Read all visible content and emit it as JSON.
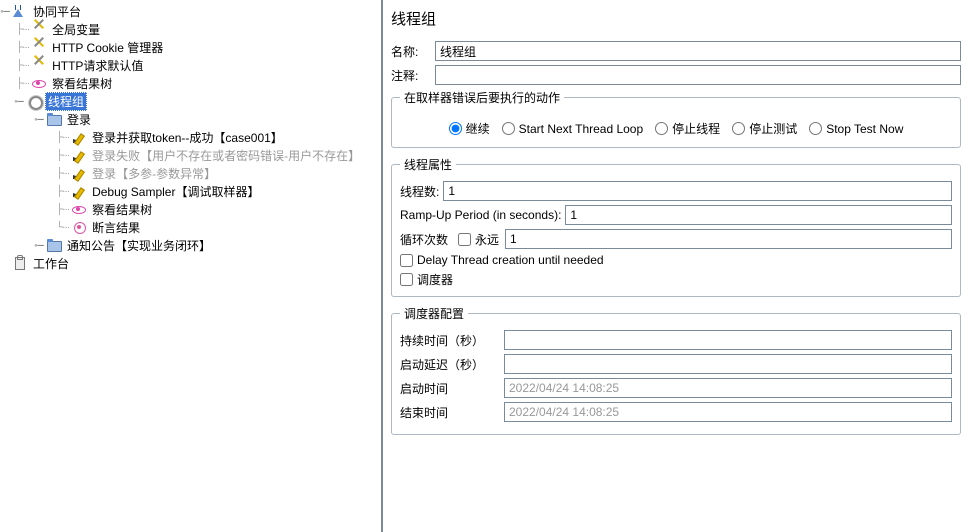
{
  "tree": {
    "root": "协同平台",
    "n1": "全局变量",
    "n2": "HTTP Cookie 管理器",
    "n3": "HTTP请求默认值",
    "n4": "察看结果树",
    "n5": "线程组",
    "n6": "登录",
    "n7": "登录并获取token--成功【case001】",
    "n8": "登录失败【用户不存在或者密码错误-用户不存在】",
    "n9": "登录【多参-参数异常】",
    "n10": "Debug Sampler【调试取样器】",
    "n11": "察看结果树",
    "n12": "断言结果",
    "n13": "通知公告【实现业务闭环】",
    "n14": "工作台"
  },
  "title": "线程组",
  "labels": {
    "name": "名称:",
    "comment": "注释:",
    "onError": "在取样器错误后要执行的动作",
    "r1": "继续",
    "r2": "Start Next Thread Loop",
    "r3": "停止线程",
    "r4": "停止测试",
    "r5": "Stop Test Now",
    "threadProps": "线程属性",
    "threads": "线程数:",
    "ramp": "Ramp-Up Period (in seconds):",
    "loops": "循环次数",
    "forever": "永远",
    "delay": "Delay Thread creation until needed",
    "scheduler": "调度器",
    "schedConfig": "调度器配置",
    "duration": "持续时间（秒）",
    "startDelay": "启动延迟（秒）",
    "startTime": "启动时间",
    "endTime": "结束时间"
  },
  "values": {
    "name": "线程组",
    "comment": "",
    "threads": "1",
    "ramp": "1",
    "loops": "1",
    "duration": "",
    "startDelay": "",
    "startTime": "2022/04/24 14:08:25",
    "endTime": "2022/04/24 14:08:25"
  }
}
